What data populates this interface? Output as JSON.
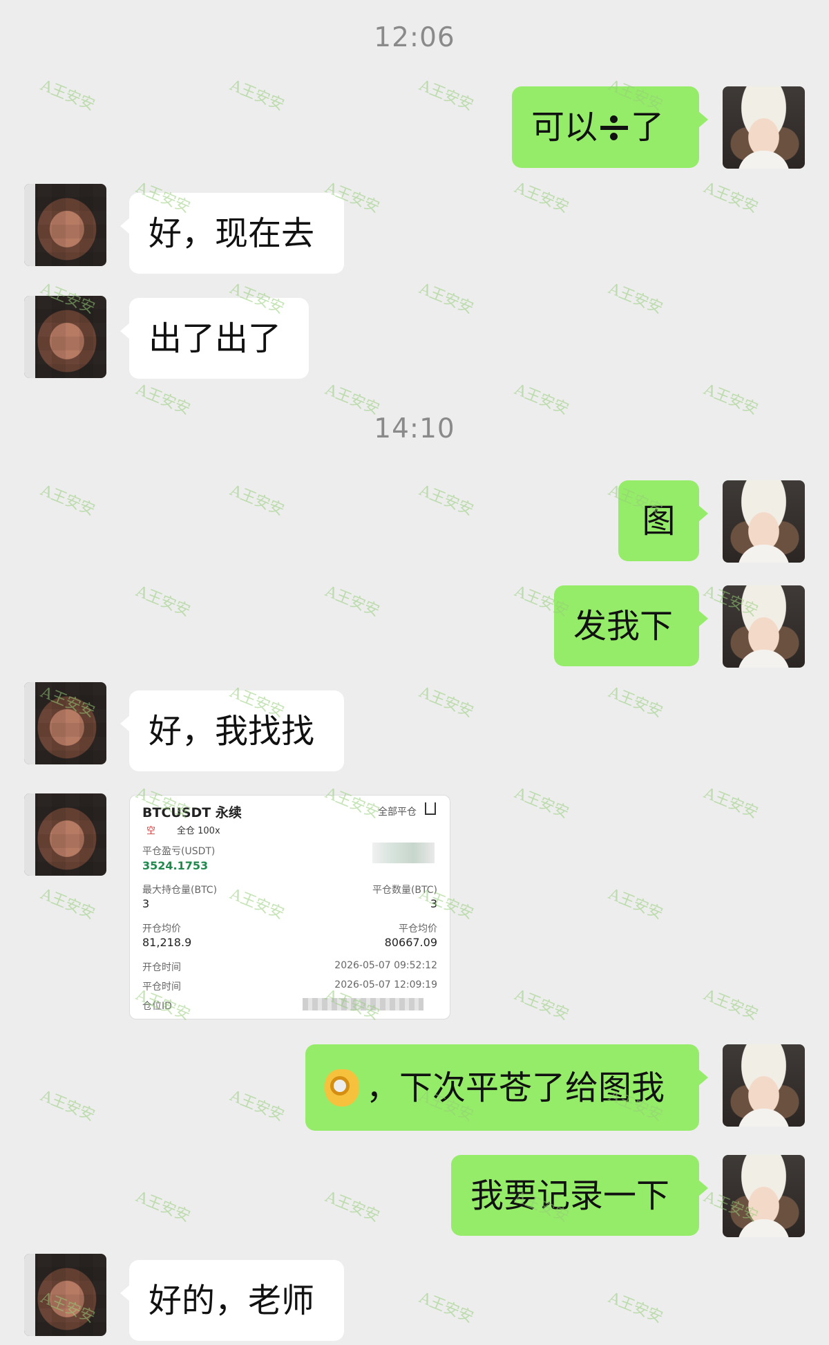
{
  "messages": [
    {
      "time": "12:06"
    },
    {
      "from": "me",
      "text_before": "可以",
      "text_after": "了",
      "icon": "division-sign-icon"
    },
    {
      "from": "other",
      "text": "好，现在去"
    },
    {
      "from": "other",
      "text": "出了出了"
    },
    {
      "time": "14:10"
    },
    {
      "from": "me",
      "text": "图"
    },
    {
      "from": "me",
      "text": "发我下"
    },
    {
      "from": "other",
      "text": "好，我找找"
    },
    {
      "from": "other",
      "type": "image"
    },
    {
      "from": "me",
      "emoji": "ok-hand-emoji",
      "text": "，下次平苍了给图我"
    },
    {
      "from": "me",
      "text": "我要记录一下"
    },
    {
      "from": "other",
      "text": "好的，老师"
    }
  ],
  "trade_card": {
    "symbol": "BTCUSDT 永续",
    "close_all": "全部平仓",
    "side": "空",
    "margin_mode": "全仓 100x",
    "pnl_label": "平仓盈亏(USDT)",
    "pnl_value": "3524.1753",
    "max_position_label": "最大持仓量(BTC)",
    "max_position_value": "3",
    "close_qty_label": "平仓数量(BTC)",
    "close_qty_value": "3",
    "open_avg_label": "开仓均价",
    "open_avg_value": "81,218.9",
    "close_avg_label": "平仓均价",
    "close_avg_value": "80667.09",
    "open_time_label": "开仓时间",
    "open_time_value": "2026-05-07 09:52:12",
    "close_time_label": "平仓时间",
    "close_time_value": "2026-05-07 12:09:19",
    "position_id_label": "仓位ID"
  },
  "watermark": "A王安安",
  "colors": {
    "background": "#ededed",
    "my_bubble": "#95ec69",
    "other_bubble": "#ffffff",
    "profit_green": "#1f8a4c",
    "short_red": "#d23b3b"
  }
}
